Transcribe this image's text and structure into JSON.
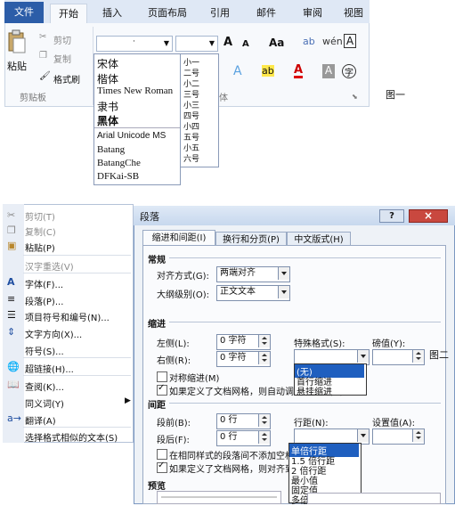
{
  "ribbon": {
    "tabs": [
      "文件",
      "开始",
      "插入",
      "页面布局",
      "引用",
      "邮件",
      "审阅",
      "视图"
    ],
    "clipboard": {
      "cut": "剪切",
      "copy": "复制",
      "format_painter": "格式刷",
      "paste": "粘贴",
      "group_label": "剪贴板"
    },
    "font_group_label": "体",
    "font_combo_value": "·",
    "font_list": [
      "宋体",
      "楷体",
      "Times New Roman",
      "隶书",
      "黑体",
      "Arial Unicode MS",
      "Batang",
      "BatangChe",
      "DFKai-SB"
    ],
    "size_list": [
      "小一",
      "二号",
      "小二",
      "三号",
      "小三",
      "四号",
      "小四",
      "五号",
      "小五",
      "六号"
    ],
    "font_size_buttons": [
      "A",
      "A",
      "Aa"
    ]
  },
  "caption1": "图一",
  "caption2": "图二",
  "context_menu": {
    "items": [
      {
        "label": "剪切(T)",
        "enabled": false
      },
      {
        "label": "复制(C)",
        "enabled": false
      },
      {
        "label": "粘贴(P)",
        "enabled": true
      },
      {
        "label": "汉字重选(V)",
        "enabled": false
      },
      {
        "label": "字体(F)...",
        "enabled": true
      },
      {
        "label": "段落(P)...",
        "enabled": true
      },
      {
        "label": "项目符号和编号(N)...",
        "enabled": true
      },
      {
        "label": "文字方向(X)...",
        "enabled": true
      },
      {
        "label": "符号(S)...",
        "enabled": true
      },
      {
        "label": "超链接(H)...",
        "enabled": true
      },
      {
        "label": "查阅(K)...",
        "enabled": true
      },
      {
        "label": "同义词(Y)",
        "enabled": true
      },
      {
        "label": "翻译(A)",
        "enabled": true
      },
      {
        "label": "选择格式相似的文本(S)",
        "enabled": true
      }
    ]
  },
  "dialog": {
    "title": "段落",
    "help": "?",
    "close": "×",
    "tabs": [
      "缩进和间距(I)",
      "换行和分页(P)",
      "中文版式(H)"
    ],
    "general": {
      "section": "常规",
      "alignment_label": "对齐方式(G):",
      "alignment_value": "两端对齐",
      "outline_label": "大纲级别(O):",
      "outline_value": "正文文本"
    },
    "indent": {
      "section": "缩进",
      "left_label": "左侧(L):",
      "left_value": "0 字符",
      "right_label": "右侧(R):",
      "right_value": "0 字符",
      "special_label": "特殊格式(S):",
      "special_value": "",
      "by_label": "磅值(Y):",
      "mirror_label": "对称缩进(M)",
      "auto_grid_label": "如果定义了文档网格，则自动调整右缩进(D)",
      "special_options": [
        "(无)",
        "首行缩进",
        "悬挂缩进"
      ]
    },
    "spacing": {
      "section": "间距",
      "before_label": "段前(B):",
      "before_value": "0 行",
      "after_label": "段后(F):",
      "after_value": "0 行",
      "line_label": "行距(N):",
      "line_value": "",
      "at_label": "设置值(A):",
      "no_space_label": "在相同样式的段落间不添加空格(C)",
      "snap_label": "如果定义了文档网格，则对齐到网格(W)",
      "line_options": [
        "单倍行距",
        "1.5 倍行距",
        "2 倍行距",
        "最小值",
        "固定值",
        "多倍行距"
      ]
    },
    "preview_section": "预览"
  },
  "colors": {
    "accent": "#2c5da8",
    "highlight": "#1f5fbf"
  }
}
